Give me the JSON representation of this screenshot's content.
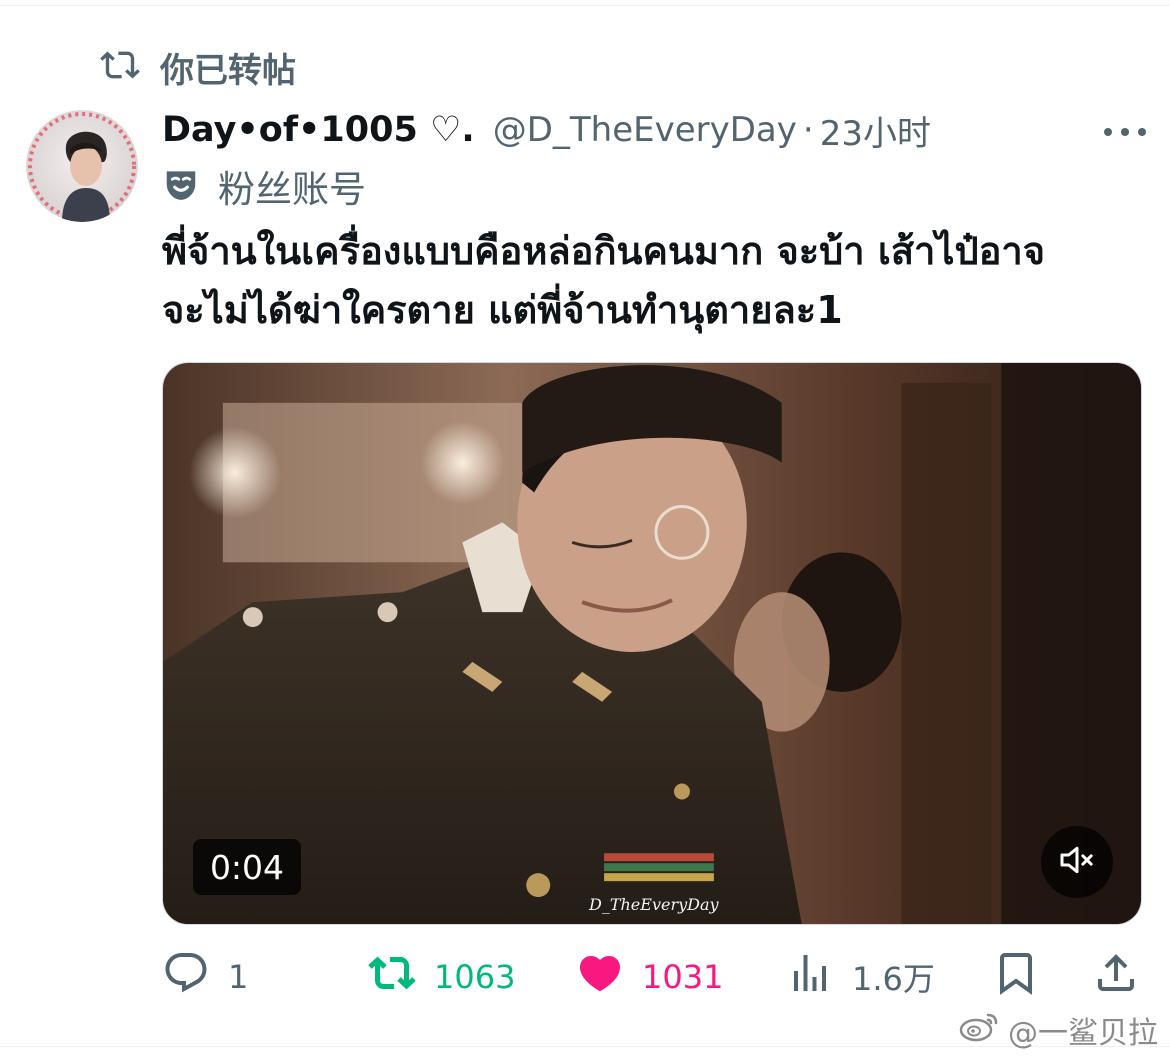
{
  "repost": {
    "label": "你已转帖"
  },
  "tweet": {
    "display_name": "Day•of•1005 ♡.",
    "handle": "@D_TheEveryDay",
    "separator": "·",
    "time": "23小时",
    "fan_label": "粉丝账号",
    "text_line1": "พี่จ้านในเครื่องแบบคือหล่อกินคนมาก จะบ้า เส้าไป๋อาจ",
    "text_line2": "จะไม่ได้ฆ่าใครตาย แต่พี่จ้านทำนุตายละ1"
  },
  "video": {
    "duration": "0:04",
    "watermark": "D_TheEveryDay"
  },
  "actions": {
    "reply_count": "1",
    "retweet_count": "1063",
    "like_count": "1031",
    "views_count": "1.6万"
  },
  "watermark": {
    "text": "@一鲨贝拉"
  },
  "colors": {
    "retweet_active": "#00ba7c",
    "like_active": "#f91880",
    "secondary_text": "#536471"
  },
  "icons": [
    "retweet-icon",
    "more-icon",
    "fan-account-icon",
    "reply-icon",
    "like-icon",
    "views-icon",
    "bookmark-icon",
    "share-icon",
    "mute-icon",
    "weibo-icon"
  ]
}
